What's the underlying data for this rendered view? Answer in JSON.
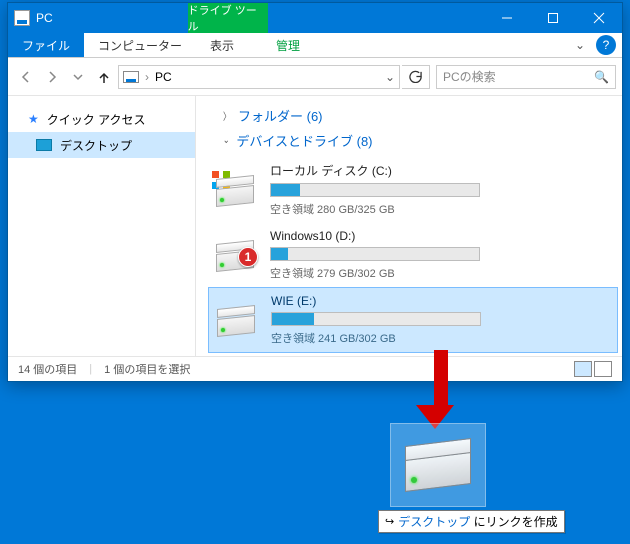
{
  "window": {
    "title": "PC",
    "contextual_tab": "ドライブ ツール"
  },
  "ribbon": {
    "file": "ファイル",
    "computer": "コンピューター",
    "view": "表示",
    "manage": "管理"
  },
  "address": {
    "location": "PC",
    "search_placeholder": "PCの検索"
  },
  "nav": {
    "quick_access": "クイック アクセス",
    "desktop": "デスクトップ"
  },
  "groups": {
    "folders": "フォルダー (6)",
    "devices": "デバイスとドライブ (8)"
  },
  "drives": [
    {
      "name": "ローカル ディスク (C:)",
      "space": "空き領域 280 GB/325 GB",
      "fill": 14
    },
    {
      "name": "Windows10 (D:)",
      "space": "空き領域 279 GB/302 GB",
      "fill": 8
    },
    {
      "name": "WIE (E:)",
      "space": "空き領域 241 GB/302 GB",
      "fill": 20
    }
  ],
  "badge": "1",
  "status": {
    "items": "14 個の項目",
    "selected": "1 個の項目を選択"
  },
  "drag_tip": {
    "pre": "デスクトップ ",
    "post": "にリンクを作成"
  }
}
